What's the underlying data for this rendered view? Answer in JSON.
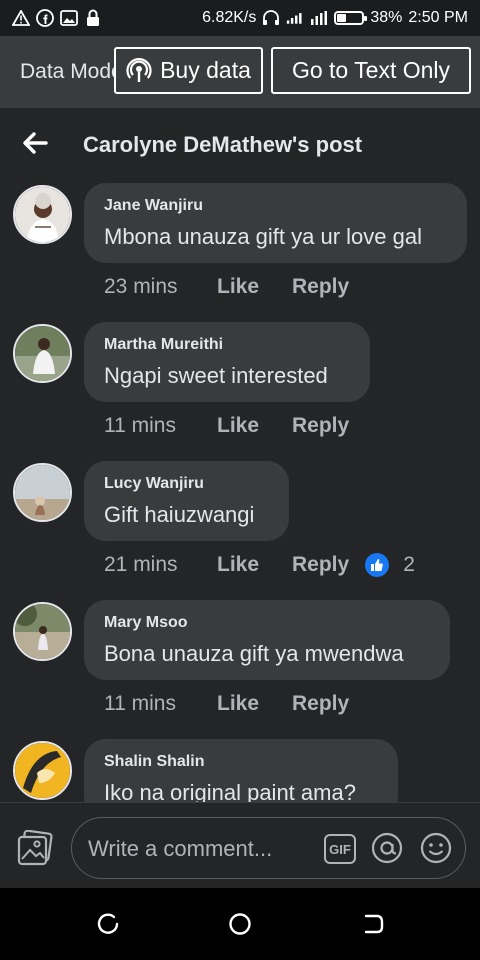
{
  "status_bar": {
    "speed": "6.82K/s",
    "battery": "38%",
    "battery_level": 0.38,
    "time": "2:50 PM",
    "icons": [
      "warning-icon",
      "facebook-icon",
      "image-icon",
      "lock-icon",
      "headset-icon",
      "signal-icon",
      "wifi-icon",
      "battery-icon"
    ]
  },
  "data_bar": {
    "label": "Data Mode",
    "buy_data": "Buy data",
    "go_text_only": "Go to Text Only"
  },
  "header": {
    "title": "Carolyne DeMathew's post"
  },
  "comments": [
    {
      "author": "Jane Wanjiru",
      "text": "Mbona unauza gift ya ur love gal",
      "time": "23 mins",
      "like": "Like",
      "reply": "Reply",
      "avatar_color": "#c9b8a8"
    },
    {
      "author": "Martha Mureithi",
      "text": "Ngapi sweet interested",
      "time": "11 mins",
      "like": "Like",
      "reply": "Reply",
      "avatar_color": "#7d8a6e"
    },
    {
      "author": "Lucy Wanjiru",
      "text": "Gift haiuzwangi",
      "time": "21 mins",
      "like": "Like",
      "reply": "Reply",
      "reaction_count": "2",
      "avatar_color": "#a9b4bd"
    },
    {
      "author": "Mary Msoo",
      "text": "Bona unauza gift ya mwendwa",
      "time": "11 mins",
      "like": "Like",
      "reply": "Reply",
      "avatar_color": "#8a9a7a"
    },
    {
      "author": "Shalin Shalin",
      "text": "Iko na original paint ama?",
      "avatar_color": "#e0a21c"
    }
  ],
  "composer": {
    "placeholder": "Write a comment...",
    "gif_label": "GIF"
  },
  "colors": {
    "background": "#242526",
    "bubble": "#3a3b3c",
    "accent": "#1877f2",
    "muted_text": "#b0b3b8"
  }
}
